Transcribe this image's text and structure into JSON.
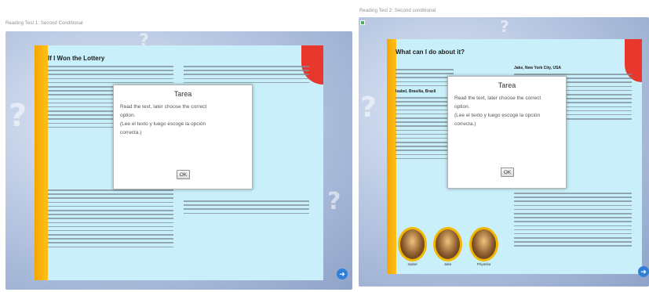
{
  "left": {
    "caption": "Reading Test 1: Second Conditional",
    "doc_title": "If I Won the Lottery",
    "modal": {
      "title": "Tarea",
      "line1": "Read the text, later choose the correct",
      "line2": "option.",
      "line3": "(Lee el texto y luego escoge la opción",
      "line4": "correcta.)",
      "ok": "OK"
    }
  },
  "right": {
    "caption": "Reading Test 2: Second conditional",
    "doc_title": "What can I do about it?",
    "sub1": "Jake, New York City, USA",
    "sub2": "Isabel, Brasilia, Brazil",
    "modal": {
      "title": "Tarea",
      "line1": "Read the text, later choose the correct",
      "line2": "option.",
      "line3": "(Lee el texto y luego escoge la opción",
      "line4": "correcta.)",
      "ok": "OK"
    },
    "avatars": [
      "Isabel",
      "Jake",
      "Priyanka"
    ]
  },
  "colors": {
    "sheet": "#c9f0fa",
    "stripe": "#f5a400",
    "corner": "#e8382e",
    "nav": "#2f80d9"
  },
  "icons": {
    "next": "arrow-right-icon"
  }
}
